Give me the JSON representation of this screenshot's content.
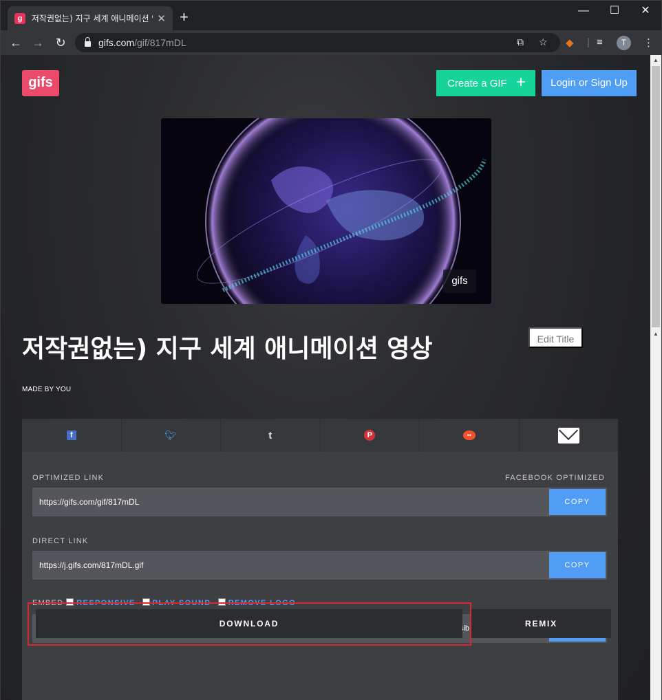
{
  "browser": {
    "tab_favicon": "g",
    "tab_title": "저작권없는) 지구 세계 애니메이션 영상",
    "tab_close": "✕",
    "new_tab": "+",
    "win_min": "—",
    "win_max": "☐",
    "win_close": "✕",
    "url_host": "gifs.com",
    "url_path": "/gif/817mDL",
    "avatar_letter": "T"
  },
  "header": {
    "logo": "gifs",
    "create_label": "Create a GIF",
    "create_plus": "+",
    "login_label": "Login or Sign Up"
  },
  "media": {
    "watermark": "gifs"
  },
  "gif": {
    "title": "저작권없는) 지구 세계 애니메이션 영상",
    "edit_label": "Edit Title",
    "made_by": "MADE BY YOU"
  },
  "share": {
    "icons": [
      "facebook-icon",
      "twitter-icon",
      "tumblr-icon",
      "pinterest-icon",
      "reddit-icon",
      "email-icon"
    ]
  },
  "links": {
    "optimized_label": "OPTIMIZED LINK",
    "facebook_label": "FACEBOOK OPTIMIZED",
    "optimized_url": "https://gifs.com/gif/817mDL",
    "direct_label": "DIRECT LINK",
    "direct_url": "https://j.gifs.com/817mDL.gif",
    "embed_label": "EMBED",
    "embed_options": [
      "RESPONSIVE",
      "PLAY SOUND",
      "REMOVE LOGO"
    ],
    "embed_code": "<iframe src='//gifs.com/embed/817mDL' frameborder='0' scrolling='no' width='640px' height='360px' style='-webkit-backface-visib",
    "copy_label": "COPY"
  },
  "actions": {
    "download_label": "DOWNLOAD",
    "remix_label": "REMIX"
  },
  "colors": {
    "create_button": "#16d39a",
    "login_button": "#4f9df5",
    "logo": "#ec4a6c",
    "highlight_outline": "#d9262f"
  }
}
